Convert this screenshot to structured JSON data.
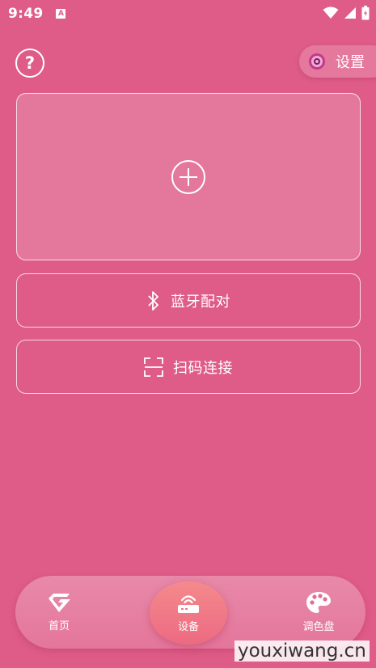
{
  "status_bar": {
    "time": "9:49",
    "notification_badge": "A"
  },
  "header": {
    "settings_label": "设置"
  },
  "actions": {
    "bluetooth_label": "蓝牙配对",
    "scan_label": "扫码连接"
  },
  "nav": {
    "items": [
      {
        "label": "首页",
        "icon": "home-icon"
      },
      {
        "label": "设备",
        "icon": "router-icon",
        "active": true
      },
      {
        "label": "调色盘",
        "icon": "palette-icon"
      }
    ]
  },
  "watermark": "youxiwang.cn",
  "colors": {
    "background": "#df5c88",
    "active_tab": "#f07e87",
    "foreground": "#ffffff"
  }
}
